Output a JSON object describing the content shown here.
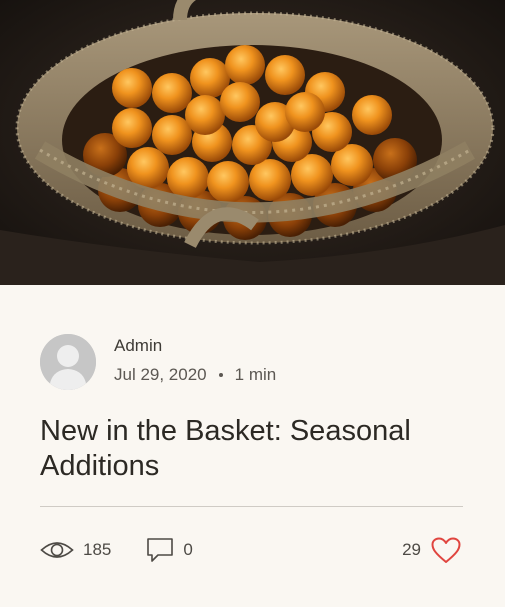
{
  "post": {
    "cover_alt": "Basket of oranges",
    "author": "Admin",
    "date": "Jul 29, 2020",
    "read_time": "1 min",
    "title": "New in the Basket: Seasonal Additions"
  },
  "stats": {
    "views": "185",
    "comments": "0",
    "likes": "29"
  },
  "icons": {
    "views": "eye-icon",
    "comments": "comment-icon",
    "likes": "heart-icon"
  },
  "colors": {
    "background": "#faf7f2",
    "heart": "#e0453f",
    "text": "#2c2924"
  }
}
